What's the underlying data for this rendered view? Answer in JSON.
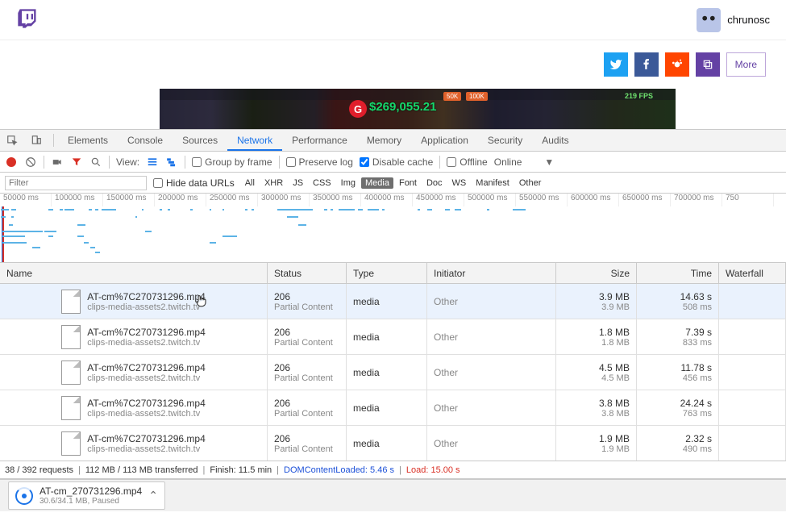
{
  "header": {
    "username": "chrunosc"
  },
  "share": {
    "more": "More"
  },
  "video": {
    "price": "$269,055.21",
    "g": "G",
    "fps": "219 FPS",
    "pill1": "50K",
    "pill2": "100K"
  },
  "devtabs": {
    "elements": "Elements",
    "console": "Console",
    "sources": "Sources",
    "network": "Network",
    "performance": "Performance",
    "memory": "Memory",
    "application": "Application",
    "security": "Security",
    "audits": "Audits"
  },
  "toolbar": {
    "view": "View:",
    "groupByFrame": "Group by frame",
    "preserveLog": "Preserve log",
    "disableCache": "Disable cache",
    "offline": "Offline",
    "online": "Online"
  },
  "filterRow": {
    "placeholder": "Filter",
    "hideDataUrls": "Hide data URLs",
    "types": [
      "All",
      "XHR",
      "JS",
      "CSS",
      "Img",
      "Media",
      "Font",
      "Doc",
      "WS",
      "Manifest",
      "Other"
    ]
  },
  "ruler": [
    "50000 ms",
    "100000 ms",
    "150000 ms",
    "200000 ms",
    "250000 ms",
    "300000 ms",
    "350000 ms",
    "400000 ms",
    "450000 ms",
    "500000 ms",
    "550000 ms",
    "600000 ms",
    "650000 ms",
    "700000 ms",
    "750"
  ],
  "columns": {
    "name": "Name",
    "status": "Status",
    "type": "Type",
    "initiator": "Initiator",
    "size": "Size",
    "time": "Time",
    "waterfall": "Waterfall"
  },
  "rows": [
    {
      "name": "AT-cm%7C270731296.mp4",
      "host": "clips-media-assets2.twitch.tv",
      "statusCode": "206",
      "statusText": "Partial Content",
      "type": "media",
      "initiator": "Other",
      "size": "3.9 MB",
      "size2": "3.9 MB",
      "time": "14.63 s",
      "time2": "508 ms",
      "sel": true
    },
    {
      "name": "AT-cm%7C270731296.mp4",
      "host": "clips-media-assets2.twitch.tv",
      "statusCode": "206",
      "statusText": "Partial Content",
      "type": "media",
      "initiator": "Other",
      "size": "1.8 MB",
      "size2": "1.8 MB",
      "time": "7.39 s",
      "time2": "833 ms"
    },
    {
      "name": "AT-cm%7C270731296.mp4",
      "host": "clips-media-assets2.twitch.tv",
      "statusCode": "206",
      "statusText": "Partial Content",
      "type": "media",
      "initiator": "Other",
      "size": "4.5 MB",
      "size2": "4.5 MB",
      "time": "11.78 s",
      "time2": "456 ms"
    },
    {
      "name": "AT-cm%7C270731296.mp4",
      "host": "clips-media-assets2.twitch.tv",
      "statusCode": "206",
      "statusText": "Partial Content",
      "type": "media",
      "initiator": "Other",
      "size": "3.8 MB",
      "size2": "3.8 MB",
      "time": "24.24 s",
      "time2": "763 ms"
    },
    {
      "name": "AT-cm%7C270731296.mp4",
      "host": "clips-media-assets2.twitch.tv",
      "statusCode": "206",
      "statusText": "Partial Content",
      "type": "media",
      "initiator": "Other",
      "size": "1.9 MB",
      "size2": "1.9 MB",
      "time": "2.32 s",
      "time2": "490 ms"
    }
  ],
  "summary": {
    "requests": "38 / 392 requests",
    "transferred": "112 MB / 113 MB transferred",
    "finish": "Finish: 11.5 min",
    "dclLabel": "DOMContentLoaded: 5.46 s",
    "loadLabel": "Load: 15.00 s"
  },
  "download": {
    "name": "AT-cm_270731296.mp4",
    "sub": "30.6/34.1 MB, Paused"
  },
  "ov_lines": [
    [
      1,
      3,
      8,
      2
    ],
    [
      1,
      12,
      6,
      2
    ],
    [
      6,
      3,
      5,
      2
    ],
    [
      14,
      3,
      6,
      2
    ],
    [
      14,
      12,
      3,
      2
    ],
    [
      11,
      22,
      5,
      2
    ],
    [
      3,
      30,
      50,
      2
    ],
    [
      3,
      36,
      28,
      2
    ],
    [
      3,
      44,
      30,
      2
    ],
    [
      40,
      50,
      10,
      2
    ],
    [
      60,
      3,
      6,
      2
    ],
    [
      55,
      30,
      15,
      2
    ],
    [
      60,
      36,
      6,
      2
    ],
    [
      74,
      3,
      4,
      2
    ],
    [
      80,
      3,
      12,
      2
    ],
    [
      118,
      3,
      4,
      2
    ],
    [
      110,
      3,
      4,
      2
    ],
    [
      126,
      3,
      18,
      2
    ],
    [
      96,
      22,
      10,
      2
    ],
    [
      96,
      36,
      8,
      2
    ],
    [
      104,
      44,
      6,
      2
    ],
    [
      112,
      50,
      6,
      2
    ],
    [
      118,
      56,
      6,
      2
    ],
    [
      176,
      3,
      2,
      2
    ],
    [
      168,
      12,
      2,
      2
    ],
    [
      180,
      30,
      8,
      2
    ],
    [
      198,
      3,
      3,
      2
    ],
    [
      208,
      3,
      3,
      2
    ],
    [
      236,
      3,
      3,
      2
    ],
    [
      260,
      3,
      2,
      2
    ],
    [
      276,
      3,
      2,
      2
    ],
    [
      276,
      36,
      18,
      2
    ],
    [
      260,
      44,
      8,
      2
    ],
    [
      304,
      3,
      3,
      2
    ],
    [
      312,
      3,
      3,
      2
    ],
    [
      344,
      3,
      44,
      2
    ],
    [
      356,
      12,
      14,
      2
    ],
    [
      370,
      22,
      10,
      2
    ],
    [
      402,
      3,
      4,
      2
    ],
    [
      410,
      3,
      3,
      2
    ],
    [
      420,
      3,
      20,
      2
    ],
    [
      444,
      3,
      6,
      2
    ],
    [
      456,
      3,
      14,
      2
    ],
    [
      474,
      3,
      3,
      2
    ],
    [
      518,
      3,
      3,
      2
    ],
    [
      530,
      3,
      6,
      2
    ],
    [
      552,
      3,
      6,
      2
    ],
    [
      564,
      3,
      8,
      2
    ],
    [
      604,
      3,
      3,
      2
    ],
    [
      636,
      3,
      16,
      2
    ]
  ],
  "ov_red": 3,
  "ov_blue": 2
}
